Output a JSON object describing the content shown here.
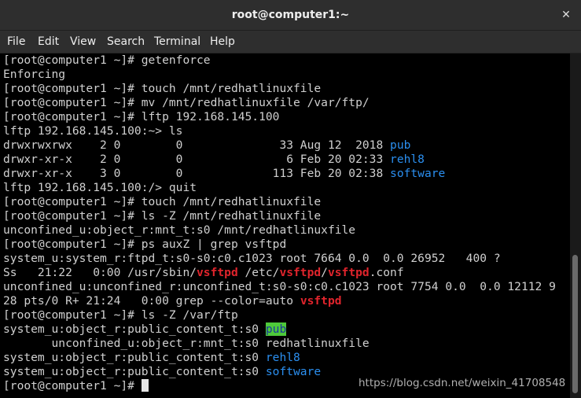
{
  "window": {
    "title": "root@computer1:~",
    "close_glyph": "✕"
  },
  "menu": {
    "items": [
      "File",
      "Edit",
      "View",
      "Search",
      "Terminal",
      "Help"
    ]
  },
  "terminal": {
    "lines": [
      [
        {
          "t": "[root@computer1 ~]# getenforce"
        }
      ],
      [
        {
          "t": "Enforcing"
        }
      ],
      [
        {
          "t": "[root@computer1 ~]# touch /mnt/redhatlinuxfile"
        }
      ],
      [
        {
          "t": "[root@computer1 ~]# mv /mnt/redhatlinuxfile /var/ftp/"
        }
      ],
      [
        {
          "t": "[root@computer1 ~]# lftp 192.168.145.100"
        }
      ],
      [
        {
          "t": "lftp 192.168.145.100:~> ls"
        }
      ],
      [
        {
          "t": "drwxrwxrwx    2 0        0              33 Aug 12  2018 "
        },
        {
          "t": "pub",
          "c": "blue"
        }
      ],
      [
        {
          "t": "drwxr-xr-x    2 0        0               6 Feb 20 02:33 "
        },
        {
          "t": "rehl8",
          "c": "blue"
        }
      ],
      [
        {
          "t": "drwxr-xr-x    3 0        0             113 Feb 20 02:38 "
        },
        {
          "t": "software",
          "c": "blue"
        }
      ],
      [
        {
          "t": "lftp 192.168.145.100:/> quit"
        }
      ],
      [
        {
          "t": "[root@computer1 ~]# touch /mnt/redhatlinuxfile"
        }
      ],
      [
        {
          "t": "[root@computer1 ~]# ls -Z /mnt/redhatlinuxfile"
        }
      ],
      [
        {
          "t": "unconfined_u:object_r:mnt_t:s0 /mnt/redhatlinuxfile"
        }
      ],
      [
        {
          "t": "[root@computer1 ~]# ps auxZ | grep vsftpd"
        }
      ],
      [
        {
          "t": "system_u:system_r:ftpd_t:s0-s0:c0.c1023 root 7664 0.0  0.0 26952   400 ?"
        }
      ],
      [
        {
          "t": "Ss   21:22   0:00 /usr/sbin/"
        },
        {
          "t": "vsftpd",
          "c": "red"
        },
        {
          "t": " /etc/"
        },
        {
          "t": "vsftpd",
          "c": "red"
        },
        {
          "t": "/"
        },
        {
          "t": "vsftpd",
          "c": "red"
        },
        {
          "t": ".conf"
        }
      ],
      [
        {
          "t": "unconfined_u:unconfined_r:unconfined_t:s0-s0:c0.c1023 root 7754 0.0  0.0 12112 9"
        }
      ],
      [
        {
          "t": "28 pts/0 R+ 21:24   0:00 grep --color=auto "
        },
        {
          "t": "vsftpd",
          "c": "red"
        }
      ],
      [
        {
          "t": "[root@computer1 ~]# ls -Z /var/ftp"
        }
      ],
      [
        {
          "t": "system_u:object_r:public_content_t:s0 "
        },
        {
          "t": "pub",
          "c": "pub"
        }
      ],
      [
        {
          "t": "       unconfined_u:object_r:mnt_t:s0 redhatlinuxfile"
        }
      ],
      [
        {
          "t": "system_u:object_r:public_content_t:s0 "
        },
        {
          "t": "rehl8",
          "c": "blue"
        }
      ],
      [
        {
          "t": "system_u:object_r:public_content_t:s0 "
        },
        {
          "t": "software",
          "c": "blue"
        }
      ],
      [
        {
          "t": "[root@computer1 ~]# "
        },
        {
          "cursor": true
        }
      ]
    ]
  },
  "watermark": "https://blog.csdn.net/weixin_41708548"
}
